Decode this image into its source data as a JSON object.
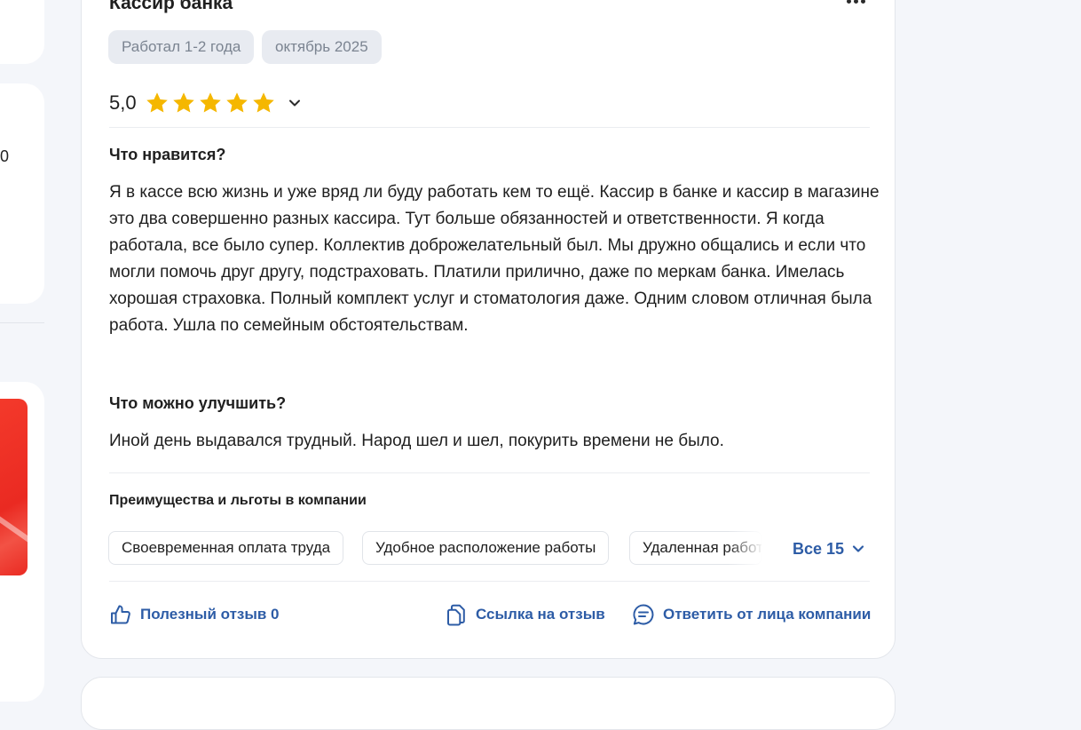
{
  "left": {
    "digit": "0"
  },
  "review": {
    "title": "Кассир банка",
    "tags": [
      "Работал 1-2 года",
      "октябрь 2025"
    ],
    "rating": {
      "value": "5,0",
      "stars": 5,
      "max": 5,
      "star_color": "#f5b700"
    },
    "likes_heading": "Что нравится?",
    "likes_text": "Я в кассе всю жизнь и уже вряд ли буду работать кем то ещё. Кассир в банке и кассир в магазине это два совершенно разных кассира. Тут больше обязанностей и ответственности. Я когда работала, все было супер. Коллектив доброжелательный был. Мы дружно общались и если что могли помочь друг другу, подстраховать. Платили прилично, даже по меркам банка. Имелась хорошая страховка. Полный комплект услуг и стоматология даже. Одним словом отличная была работа. Ушла по семейным обстоятельствам.",
    "improve_heading": "Что можно улучшить?",
    "improve_text": "Иной день выдавался трудный. Народ шел и шел, покурить времени не было.",
    "benefits": {
      "heading": "Преимущества и льготы в компании",
      "chips": [
        "Своевременная оплата труда",
        "Удобное расположение работы",
        "Удаленная работа"
      ],
      "all_label": "Все 15"
    },
    "actions": {
      "useful": "Полезный отзыв 0",
      "link": "Ссылка на отзыв",
      "reply": "Ответить от лица компании"
    }
  },
  "colors": {
    "accent": "#2d5ca6",
    "tag_bg": "#e8ebf1",
    "tag_text": "#7b8491",
    "page_bg": "#f4f6fa",
    "banner_red": "#ea2a22"
  },
  "icons": [
    "more-icon",
    "star-icon",
    "chevron-down-icon",
    "thumbs-up-icon",
    "copy-link-icon",
    "chat-icon"
  ]
}
